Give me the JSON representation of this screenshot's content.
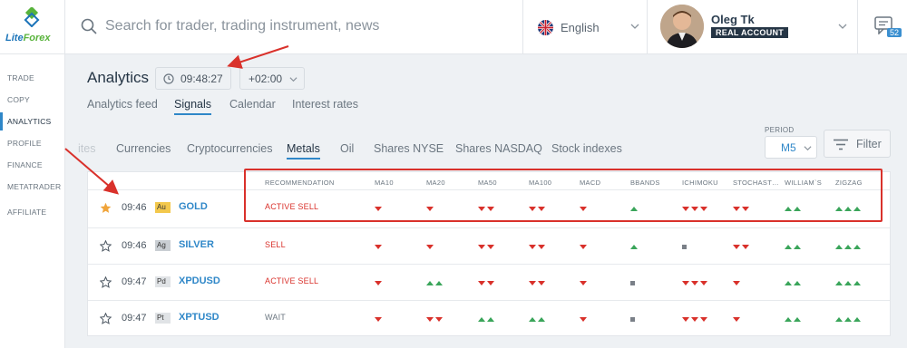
{
  "header": {
    "logo_text_a": "Lite",
    "logo_text_b": "Forex",
    "search_placeholder": "Search for trader, trading instrument, news",
    "language": "English",
    "user_name": "Oleg Tk",
    "account_badge": "REAL ACCOUNT",
    "notification_count": "52"
  },
  "sidebar": {
    "items": [
      {
        "label": "TRADE"
      },
      {
        "label": "COPY"
      },
      {
        "label": "ANALYTICS"
      },
      {
        "label": "PROFILE"
      },
      {
        "label": "FINANCE"
      },
      {
        "label": "METATRADER"
      },
      {
        "label": "AFFILIATE"
      }
    ]
  },
  "page": {
    "title": "Analytics",
    "time": "09:48:27",
    "timezone": "+02:00"
  },
  "tabs": [
    {
      "label": "Analytics feed"
    },
    {
      "label": "Signals"
    },
    {
      "label": "Calendar"
    },
    {
      "label": "Interest rates"
    }
  ],
  "categories": [
    {
      "label": "ites"
    },
    {
      "label": "Currencies"
    },
    {
      "label": "Cryptocurrencies"
    },
    {
      "label": "Metals"
    },
    {
      "label": "Oil"
    },
    {
      "label": "Shares NYSE"
    },
    {
      "label": "Shares NASDAQ"
    },
    {
      "label": "Stock indexes"
    }
  ],
  "period": {
    "label": "PERIOD",
    "value": "M5"
  },
  "filter_label": "Filter",
  "table": {
    "columns": [
      "RECOMMENDATION",
      "MA10",
      "MA20",
      "MA50",
      "MA100",
      "MACD",
      "BBANDS",
      "ICHIMOKU",
      "STOCHAST…",
      "WILLIAM`S",
      "ZIGZAG"
    ],
    "rows": [
      {
        "time": "09:46",
        "badge": "Au",
        "symbol": "GOLD",
        "recommendation": "ACTIVE SELL",
        "favorite": true,
        "signals": [
          "d1",
          "d1",
          "d2",
          "d2",
          "d1",
          "u1",
          "d3",
          "d2",
          "u2",
          "u3"
        ]
      },
      {
        "time": "09:46",
        "badge": "Ag",
        "symbol": "SILVER",
        "recommendation": "SELL",
        "favorite": false,
        "signals": [
          "d1",
          "d1",
          "d2",
          "d2",
          "d1",
          "u1",
          "n1",
          "d2",
          "u2",
          "u3"
        ]
      },
      {
        "time": "09:47",
        "badge": "Pd",
        "symbol": "XPDUSD",
        "recommendation": "ACTIVE SELL",
        "favorite": false,
        "signals": [
          "d1",
          "u2",
          "d2",
          "d2",
          "d1",
          "n1",
          "d3",
          "d1",
          "u2",
          "u3"
        ]
      },
      {
        "time": "09:47",
        "badge": "Pt",
        "symbol": "XPTUSD",
        "recommendation": "WAIT",
        "favorite": false,
        "signals": [
          "d1",
          "d2",
          "u2",
          "u2",
          "d1",
          "n1",
          "d3",
          "d1",
          "u2",
          "u3"
        ]
      }
    ]
  },
  "colors": {
    "accent": "#2f87c8",
    "sell": "#d9312b",
    "buy": "#3aa55a",
    "neutral": "#7a8088",
    "wait": "#6b7680",
    "badge_au": "#f3c84c",
    "badge_ag": "#c9ced3",
    "badge_pd": "#e0e3e6",
    "badge_pt": "#e0e3e6"
  }
}
